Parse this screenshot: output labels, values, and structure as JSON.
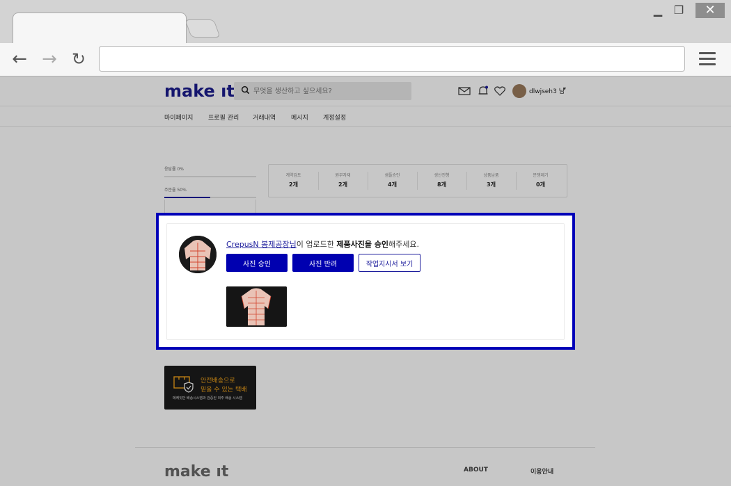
{
  "browser": {
    "address": "",
    "window_controls": {
      "minimize": "▁",
      "maximize": "❐",
      "close": "✕"
    },
    "nav": {
      "back": "←",
      "forward": "→",
      "reload": "↻"
    }
  },
  "site": {
    "logo": "make ıt",
    "search": {
      "placeholder": "무엇을 생산하고 싶으세요?"
    },
    "username": "dlwjseh3 님",
    "user_caret": "▾",
    "subnav": [
      "마이페이지",
      "프로필 관리",
      "거래내역",
      "메시지",
      "계정설정"
    ]
  },
  "progress": [
    {
      "label": "응답률 0%",
      "value": 0
    },
    {
      "label": "주문율 50%",
      "value": 50
    }
  ],
  "stats": [
    {
      "label": "계약검토",
      "value": "2개"
    },
    {
      "label": "원부자재",
      "value": "2개"
    },
    {
      "label": "샘플승인",
      "value": "4개"
    },
    {
      "label": "생산진행",
      "value": "8개"
    },
    {
      "label": "상품납품",
      "value": "3개"
    },
    {
      "label": "분쟁제기",
      "value": "0개"
    }
  ],
  "modal": {
    "factory_name": "CrepusN 봉제공장님",
    "message_mid": "이 업로드한 ",
    "message_bold": "제품사진을 승인",
    "message_end": "해주세요.",
    "approve_label": "사진 승인",
    "reject_label": "사진 반려",
    "work_order_label": "작업지시서 보기"
  },
  "ad": {
    "line1": "안전배송으로",
    "line2": "믿을 수 있는 택배",
    "sub": "메케잇만 배송시스템과 검증된 외주 배송 시스템"
  },
  "footer": {
    "logo": "make ıt",
    "links": [
      "ABOUT",
      "이용안내"
    ]
  },
  "colors": {
    "brand": "#1c1c9c",
    "highlight_border": "#0000b8",
    "button_primary": "#0000b0",
    "ad_text": "#f0a21a"
  }
}
